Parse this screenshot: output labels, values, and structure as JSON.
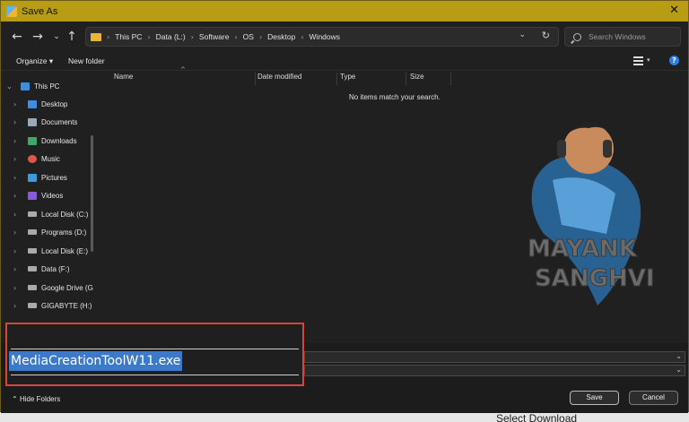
{
  "window": {
    "title": "Save As"
  },
  "nav": {
    "breadcrumbs": [
      "This PC",
      "Data (L:)",
      "Software",
      "OS",
      "Desktop",
      "Windows"
    ],
    "search_placeholder": "Search Windows"
  },
  "toolbar": {
    "organize": "Organize ▾",
    "new_folder": "New folder"
  },
  "sidebar": {
    "items": [
      {
        "label": "This PC",
        "icon": "pc-icon",
        "color": "#3a8fe0"
      },
      {
        "label": "Desktop",
        "icon": "desktop-icon",
        "color": "#3d8ee0"
      },
      {
        "label": "Documents",
        "icon": "documents-icon",
        "color": "#9aa7b5"
      },
      {
        "label": "Downloads",
        "icon": "downloads-icon",
        "color": "#3fa86a"
      },
      {
        "label": "Music",
        "icon": "music-icon",
        "color": "#e0584b"
      },
      {
        "label": "Pictures",
        "icon": "pictures-icon",
        "color": "#3b9ad9"
      },
      {
        "label": "Videos",
        "icon": "videos-icon",
        "color": "#8a5bd6"
      },
      {
        "label": "Local Disk (C:)",
        "icon": "drive-icon",
        "color": "#aaaaaa"
      },
      {
        "label": "Programs (D:)",
        "icon": "drive-icon",
        "color": "#aaaaaa"
      },
      {
        "label": "Local Disk (E:)",
        "icon": "drive-icon",
        "color": "#aaaaaa"
      },
      {
        "label": "Data (F:)",
        "icon": "drive-icon",
        "color": "#aaaaaa"
      },
      {
        "label": "Google Drive (G",
        "icon": "drive-icon",
        "color": "#aaaaaa"
      },
      {
        "label": "GIGABYTE (H:)",
        "icon": "drive-icon",
        "color": "#aaaaaa"
      }
    ]
  },
  "columns": [
    "Name",
    "Date modified",
    "Type",
    "Size"
  ],
  "empty_message": "No items match your search.",
  "watermark": {
    "line1": "MAYANK",
    "line2": "SANGHVI"
  },
  "file_name_value": "MediaCreationToolW11.exe",
  "footer": {
    "hide_folders": "Hide Folders",
    "save": "Save",
    "cancel": "Cancel"
  },
  "background_text": "Select Download",
  "colors": {
    "title_bar": "#b89d14",
    "accent": "#3c79c9",
    "highlight_box": "#d8453b"
  }
}
